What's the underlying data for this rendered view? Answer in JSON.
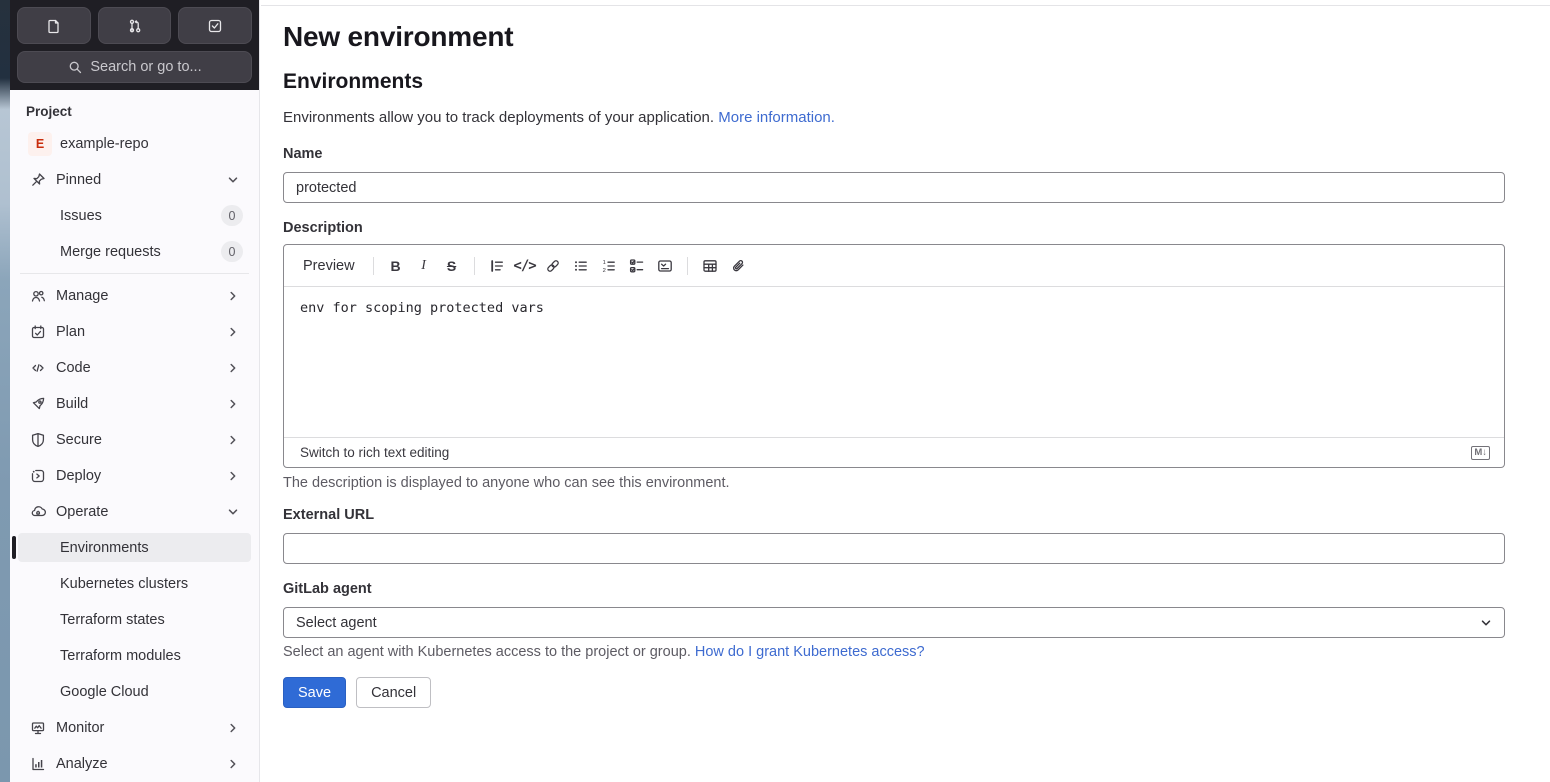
{
  "sidebar": {
    "search": {
      "placeholder": "Search or go to..."
    },
    "section_label": "Project",
    "project": {
      "avatar_letter": "E",
      "name": "example-repo"
    },
    "pinned": {
      "label": "Pinned",
      "items": [
        {
          "label": "Issues",
          "count": "0"
        },
        {
          "label": "Merge requests",
          "count": "0"
        }
      ]
    },
    "nav": [
      {
        "label": "Manage"
      },
      {
        "label": "Plan"
      },
      {
        "label": "Code"
      },
      {
        "label": "Build"
      },
      {
        "label": "Secure"
      },
      {
        "label": "Deploy"
      },
      {
        "label": "Operate"
      },
      {
        "label": "Monitor"
      },
      {
        "label": "Analyze"
      }
    ],
    "operate_items": [
      {
        "label": "Environments",
        "active": true
      },
      {
        "label": "Kubernetes clusters"
      },
      {
        "label": "Terraform states"
      },
      {
        "label": "Terraform modules"
      },
      {
        "label": "Google Cloud"
      }
    ],
    "icons": [
      "issues-icon",
      "merge-request-icon",
      "todo-icon",
      "search-icon",
      "pin-icon",
      "users-icon",
      "calendar-icon",
      "code-icon",
      "rocket-icon",
      "shield-icon",
      "deploy-icon",
      "cloud-pod-icon",
      "monitor-icon",
      "chart-icon"
    ]
  },
  "main": {
    "page_title": "New environment",
    "section_title": "Environments",
    "intro": {
      "text": "Environments allow you to track deployments of your application.",
      "link": "More information."
    },
    "name": {
      "label": "Name",
      "value": "protected"
    },
    "description": {
      "label": "Description",
      "toolbar_preview": "Preview",
      "toolbar_icons": [
        "bold-icon",
        "italic-icon",
        "strikethrough-icon",
        "quote-icon",
        "code-icon",
        "link-icon",
        "bullet-list-icon",
        "numbered-list-icon",
        "task-list-icon",
        "collapsible-section-icon",
        "table-icon",
        "attachment-icon"
      ],
      "value": "env for scoping protected vars",
      "switch_link": "Switch to rich text editing",
      "markdown_badge": "M↓"
    },
    "description_help": "The description is displayed to anyone who can see this environment.",
    "external_url": {
      "label": "External URL",
      "value": ""
    },
    "agent": {
      "label": "GitLab agent",
      "selected": "Select agent",
      "help_text": "Select an agent with Kubernetes access to the project or group.",
      "help_link": "How do I grant Kubernetes access?"
    },
    "actions": {
      "save": "Save",
      "cancel": "Cancel"
    }
  },
  "colors": {
    "accent_blue": "#2f6bd6",
    "link_blue": "#3e6bd0",
    "sidebar_dark": "#1f1e24",
    "sidebar_bg": "#fbfafd",
    "active_item_bg": "#ececef",
    "avatar_bg": "#fdf1ee",
    "avatar_text": "#c92d0c"
  }
}
